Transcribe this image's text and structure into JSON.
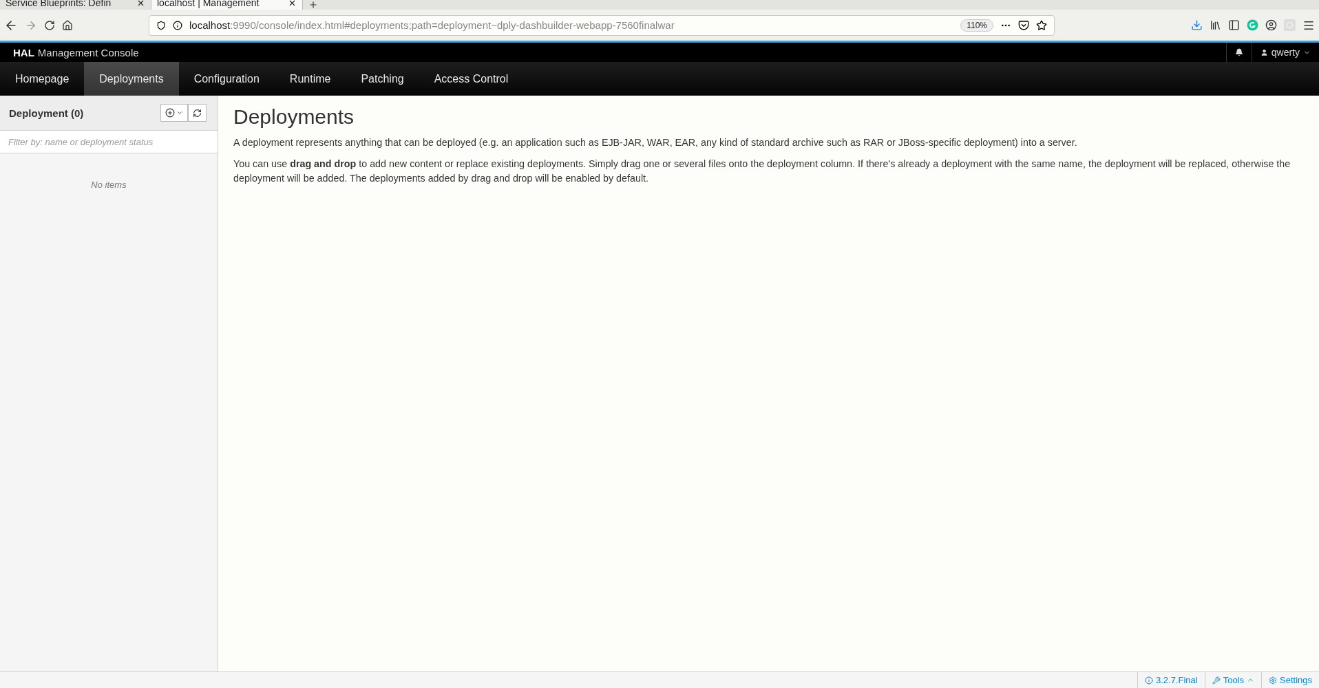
{
  "browser": {
    "tabs": [
      {
        "title": "Service Blueprints: Defin",
        "selected": false
      },
      {
        "title": "localhost | Management",
        "selected": true
      }
    ],
    "url": {
      "host": "localhost",
      "rest": ":9990/console/index.html#deployments;path=deployment~dply-dashbuilder-webapp-7560finalwar"
    },
    "zoom": "110%"
  },
  "header": {
    "brand": "HAL",
    "title": "Management Console",
    "user": "qwerty"
  },
  "nav": [
    {
      "label": "Homepage",
      "selected": false
    },
    {
      "label": "Deployments",
      "selected": true
    },
    {
      "label": "Configuration",
      "selected": false
    },
    {
      "label": "Runtime",
      "selected": false
    },
    {
      "label": "Patching",
      "selected": false
    },
    {
      "label": "Access Control",
      "selected": false
    }
  ],
  "sidebar": {
    "title": "Deployment (0)",
    "filter": {
      "placeholder": "Filter by: name or deployment status"
    },
    "empty": "No items"
  },
  "content": {
    "title": "Deployments",
    "paragraphs": [
      "A deployment represents anything that can be deployed (e.g. an application such as EJB-JAR, WAR, EAR, any kind of standard archive such as RAR or JBoss-specific deployment) into a server.",
      "You can use **drag and drop** to add new content or replace existing deployments. Simply drag one or several files onto the deployment column. If there's already a deployment with the same name, the deployment will be replaced, otherwise the deployment will be added. The deployments added by drag and drop will be enabled by default."
    ]
  },
  "footer": {
    "version": "3.2.7.Final",
    "tools": "Tools",
    "settings": "Settings"
  }
}
